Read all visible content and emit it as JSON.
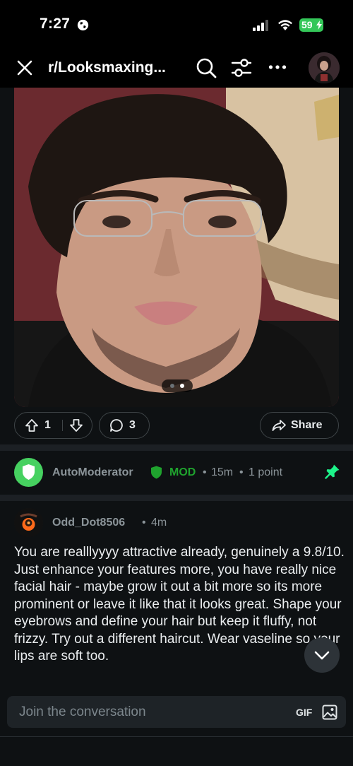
{
  "status_bar": {
    "time": "7:27",
    "battery": "59"
  },
  "header": {
    "subreddit": "r/Looksmaxing..."
  },
  "post": {
    "image_count": 2,
    "active_image": 2,
    "votes": "1",
    "comments": "3",
    "share_label": "Share"
  },
  "automod_comment": {
    "author": "AutoModerator",
    "badge": "MOD",
    "time": "15m",
    "points": "1 point",
    "dot1": "•",
    "dot2": "•"
  },
  "user_comment": {
    "author": "Odd_Dot8506",
    "time": "4m",
    "dot": "•",
    "body": "You are realllyyyy attractive already, genuinely a 9.8/10. Just enhance your features more, you have really nice facial hair - maybe grow it out a bit more so its more prominent or leave it like that it looks great. Shape your eyebrows and define your hair but keep it fluffy, not frizzy. Try out a different haircut. Wear vaseline so your lips are soft too."
  },
  "composer": {
    "placeholder": "Join the conversation",
    "gif_label": "GIF"
  },
  "colors": {
    "background": "#0e1113",
    "mod_green": "#46d160",
    "mod_badge": "#1fa32e",
    "pin": "#1df38a",
    "battery": "#34c759"
  },
  "icons": [
    "globe-icon",
    "signal-icon",
    "wifi-icon",
    "battery-icon",
    "close-icon",
    "search-icon",
    "filter-icon",
    "more-icon",
    "upvote-icon",
    "downvote-icon",
    "comment-icon",
    "share-icon",
    "shield-icon",
    "pin-icon",
    "chevron-down-icon",
    "image-icon"
  ]
}
